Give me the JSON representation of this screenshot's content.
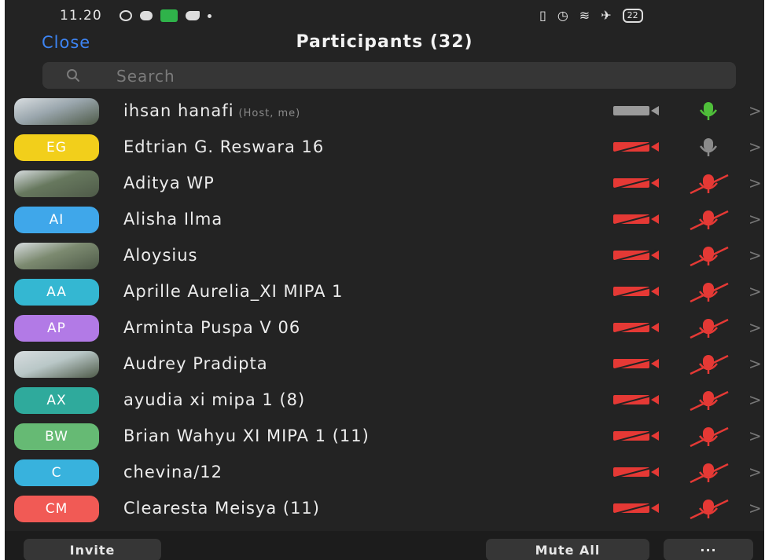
{
  "status_bar": {
    "time": "11.20",
    "battery": "22"
  },
  "header": {
    "close_label": "Close",
    "title": "Participants (32)"
  },
  "search": {
    "placeholder": "Search",
    "value": ""
  },
  "participants": [
    {
      "name": "ihsan hanafi",
      "role": "(Host, me)",
      "avatar_text": "",
      "avatar_color": "#9aa6ad",
      "avatar_type": "photo",
      "video": "off-grey",
      "audio": "on"
    },
    {
      "name": "Edtrian G. Reswara 16",
      "role": "",
      "avatar_text": "EG",
      "avatar_color": "#f2cf1b",
      "avatar_type": "initials",
      "video": "off",
      "audio": "grey"
    },
    {
      "name": "Aditya WP",
      "role": "",
      "avatar_text": "",
      "avatar_color": "#67785e",
      "avatar_type": "photo",
      "video": "off",
      "audio": "muted"
    },
    {
      "name": "Alisha Ilma",
      "role": "",
      "avatar_text": "AI",
      "avatar_color": "#3fa7ea",
      "avatar_type": "initials",
      "video": "off",
      "audio": "muted"
    },
    {
      "name": "Aloysius",
      "role": "",
      "avatar_text": "",
      "avatar_color": "#7c8a70",
      "avatar_type": "photo",
      "video": "off",
      "audio": "muted"
    },
    {
      "name": "Aprille Aurelia_XI MIPA 1",
      "role": "",
      "avatar_text": "AA",
      "avatar_color": "#34b7d2",
      "avatar_type": "initials",
      "video": "off",
      "audio": "muted"
    },
    {
      "name": "Arminta Puspa V 06",
      "role": "",
      "avatar_text": "AP",
      "avatar_color": "#b27ae6",
      "avatar_type": "initials",
      "video": "off",
      "audio": "muted"
    },
    {
      "name": "Audrey Pradipta",
      "role": "",
      "avatar_text": "",
      "avatar_color": "#b9c7c7",
      "avatar_type": "photo",
      "video": "off",
      "audio": "muted"
    },
    {
      "name": "ayudia xi mipa 1 (8)",
      "role": "",
      "avatar_text": "AX",
      "avatar_color": "#2faa9c",
      "avatar_type": "initials",
      "video": "off",
      "audio": "muted"
    },
    {
      "name": "Brian Wahyu XI MIPA 1 (11)",
      "role": "",
      "avatar_text": "BW",
      "avatar_color": "#66ba74",
      "avatar_type": "initials",
      "video": "off",
      "audio": "muted"
    },
    {
      "name": "chevina/12",
      "role": "",
      "avatar_text": "C",
      "avatar_color": "#38b2dd",
      "avatar_type": "initials",
      "video": "off",
      "audio": "muted"
    },
    {
      "name": "Clearesta Meisya (11)",
      "role": "",
      "avatar_text": "CM",
      "avatar_color": "#f15a55",
      "avatar_type": "initials",
      "video": "off",
      "audio": "muted"
    }
  ],
  "footer": {
    "invite_label": "Invite",
    "mute_all_label": "Mute All",
    "more_label": "···"
  },
  "colors": {
    "accent": "#3d84f2",
    "muted_red": "#e53935",
    "active_green": "#4fbf3a",
    "background": "#232323"
  }
}
